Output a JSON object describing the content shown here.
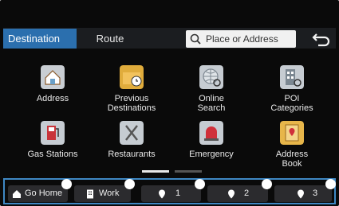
{
  "tabs": {
    "destination": "Destination",
    "route": "Route"
  },
  "search": {
    "placeholder": "Place or Address"
  },
  "menu": [
    {
      "label": "Address"
    },
    {
      "label": "Previous\nDestinations"
    },
    {
      "label": "Online\nSearch"
    },
    {
      "label": "POI\nCategories"
    },
    {
      "label": "Gas Stations"
    },
    {
      "label": "Restaurants"
    },
    {
      "label": "Emergency"
    },
    {
      "label": "Address\nBook"
    }
  ],
  "favorites": {
    "home": "Go Home",
    "work": "Work",
    "fav1": "1",
    "fav2": "2",
    "fav3": "3"
  },
  "colors": {
    "accent": "#2b6fae",
    "highlight": "#3f88c4"
  }
}
